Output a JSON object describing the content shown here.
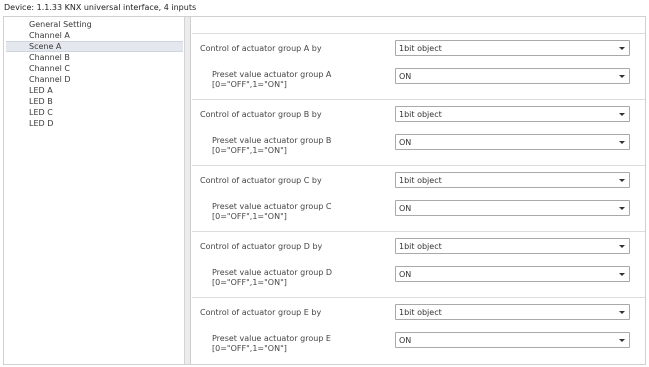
{
  "device_title": "Device: 1.1.33  KNX universal interface, 4 inputs",
  "sidebar": {
    "items": [
      {
        "label": "General Setting"
      },
      {
        "label": "Channel A"
      },
      {
        "label": "Scene A"
      },
      {
        "label": "Channel B"
      },
      {
        "label": "Channel C"
      },
      {
        "label": "Channel D"
      },
      {
        "label": "LED A"
      },
      {
        "label": "LED B"
      },
      {
        "label": "LED C"
      },
      {
        "label": "LED D"
      }
    ],
    "selected": "Scene A"
  },
  "groups": [
    {
      "control_label": "Control of actuator group A by",
      "control_value": "1bit object",
      "preset_label_1": "Preset value actuator group A",
      "preset_label_2": "[0=\"OFF\",1=\"ON\"]",
      "preset_value": "ON"
    },
    {
      "control_label": "Control of actuator group B by",
      "control_value": "1bit object",
      "preset_label_1": "Preset value actuator group B",
      "preset_label_2": "[0=\"OFF\",1=\"ON\"]",
      "preset_value": "ON"
    },
    {
      "control_label": "Control of actuator group C by",
      "control_value": "1bit object",
      "preset_label_1": "Preset value actuator group C",
      "preset_label_2": "[0=\"OFF\",1=\"ON\"]",
      "preset_value": "ON"
    },
    {
      "control_label": "Control of actuator group D by",
      "control_value": "1bit object",
      "preset_label_1": "Preset value actuator group D",
      "preset_label_2": "[0=\"OFF\",1=\"ON\"]",
      "preset_value": "ON"
    },
    {
      "control_label": "Control of actuator group E by",
      "control_value": "1bit object",
      "preset_label_1": "Preset value actuator group E",
      "preset_label_2": "[0=\"OFF\",1=\"ON\"]",
      "preset_value": "ON"
    }
  ],
  "colors": {
    "selected_item_bg": "#e4e8ee",
    "border": "#a9a9a9"
  }
}
